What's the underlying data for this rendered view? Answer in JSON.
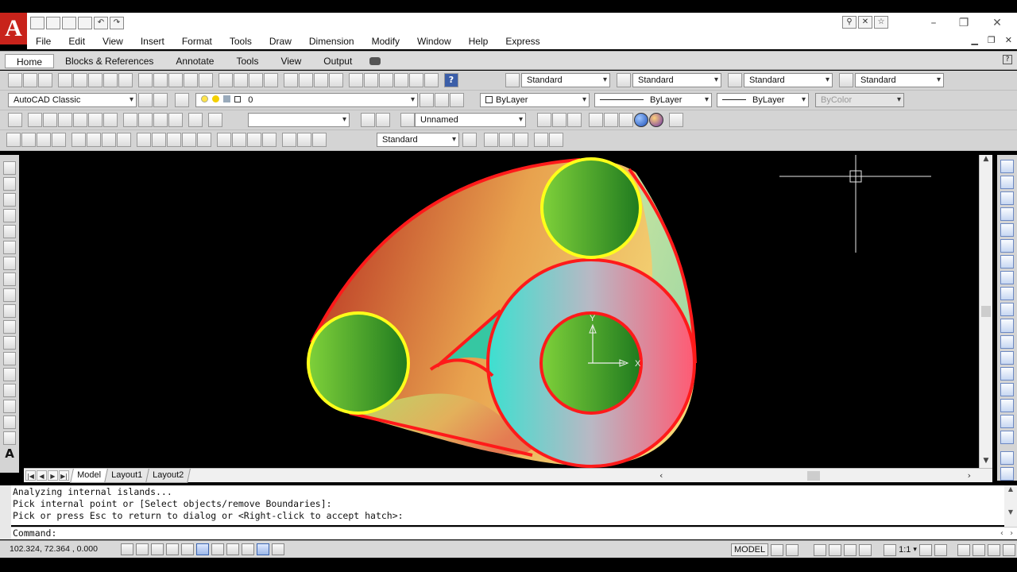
{
  "app": {
    "logo_letter": "A",
    "title_buttons": {
      "minimize": "–",
      "restore": "❐",
      "close": "✕"
    },
    "menu_doc_controls": {
      "minimize": "▁",
      "restore": "❐",
      "close": "✕"
    }
  },
  "menu": [
    "File",
    "Edit",
    "View",
    "Insert",
    "Format",
    "Tools",
    "Draw",
    "Dimension",
    "Modify",
    "Window",
    "Help",
    "Express"
  ],
  "ribbon_tabs": [
    {
      "label": "Home",
      "active": true
    },
    {
      "label": "Blocks & References",
      "active": false
    },
    {
      "label": "Annotate",
      "active": false
    },
    {
      "label": "Tools",
      "active": false
    },
    {
      "label": "View",
      "active": false
    },
    {
      "label": "Output",
      "active": false
    }
  ],
  "styles_toolbar": {
    "text_style": "Standard",
    "dim_style": "Standard",
    "table_style": "Standard",
    "mleader_style": "Standard"
  },
  "workspace": "AutoCAD Classic",
  "layer": "0",
  "color": "ByLayer",
  "linetype": "ByLayer",
  "lineweight": "ByLayer",
  "plotstyle": "ByColor",
  "visual_style": "",
  "ucs_name": "Unnamed",
  "dim_toolbar_style": "Standard",
  "ucs_icon": {
    "y_label": "Y",
    "x_label": "X"
  },
  "layout_tabs": [
    {
      "label": "Model",
      "active": true
    },
    {
      "label": "Layout1",
      "active": false
    },
    {
      "label": "Layout2",
      "active": false
    }
  ],
  "command_history": [
    "Analyzing internal islands...",
    "Pick internal point or [Select objects/remove Boundaries]:",
    "Pick or press Esc to return to dialog or <Right-click to accept hatch>:"
  ],
  "command_prompt": "Command:",
  "status": {
    "coordinates": "102.324, 72.364 , 0.000",
    "space": "MODEL",
    "annotation_scale": "1:1"
  },
  "colors": {
    "boundary": "#ff1a1a",
    "circle_outline": "#ffff1a",
    "hole_fill_dark": "#1f7a1f",
    "hole_fill_light": "#7fd13a",
    "body_grad_start": "#b3281e",
    "body_grad_end": "#f4c95a",
    "ring_grad_start": "#3ce0d0",
    "ring_grad_end": "#ff5a73"
  }
}
